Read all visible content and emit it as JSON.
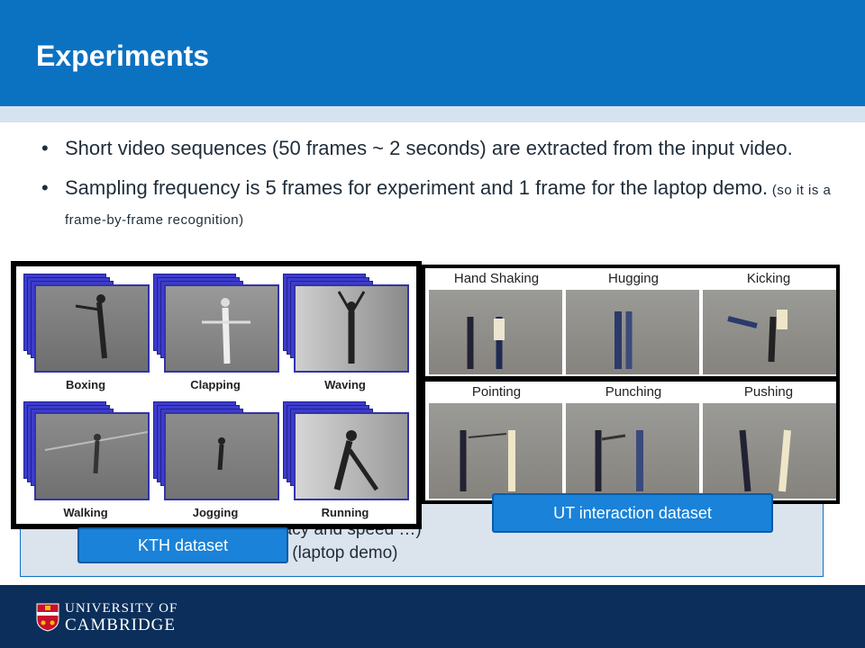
{
  "slide": {
    "title": "Experiments",
    "bullets": [
      {
        "main": "Short video sequences (50 frames ~ 2 seconds) are extracted from the input video."
      },
      {
        "main": "Sampling frequency is 5 frames for experiment and 1 frame for the laptop demo.",
        "aside": " (so it is a frame-by-frame recognition)"
      }
    ],
    "partial_lines": [
      "…  trade-off between accuracy and speed …)",
      "… (laptop demo)"
    ]
  },
  "kth": {
    "tag": "KTH dataset",
    "actions": [
      "Boxing",
      "Clapping",
      "Waving",
      "Walking",
      "Jogging",
      "Running"
    ]
  },
  "ut": {
    "tag": "UT interaction dataset",
    "row1": [
      "Hand Shaking",
      "Hugging",
      "Kicking"
    ],
    "row2": [
      "Pointing",
      "Punching",
      "Pushing"
    ]
  },
  "footer": {
    "line1": "UNIVERSITY OF",
    "line2": "CAMBRIDGE"
  },
  "colors": {
    "header": "#0b72c2",
    "footer": "#0b2f5a",
    "tag": "#1a82d8",
    "stack": "#3c3ccf"
  }
}
